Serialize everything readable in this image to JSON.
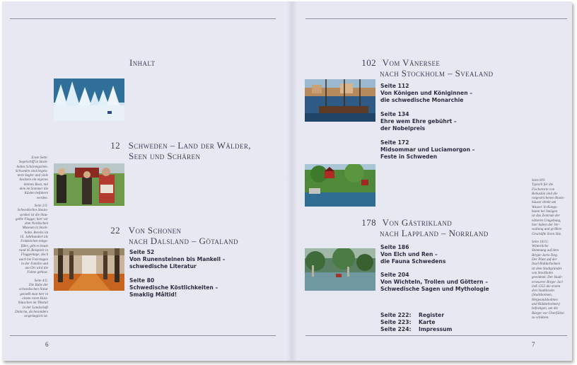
{
  "left_page": {
    "number": "6",
    "title": "Inhalt",
    "sections": [
      {
        "num": "12",
        "line1": "Schweden – Land der Wälder,",
        "line2": "Seen und Schären"
      },
      {
        "num": "22",
        "line1": "Von Schonen",
        "line2": "nach Dalsland – Götaland"
      }
    ],
    "entries": [
      {
        "page": "Seite 52",
        "lines": [
          "Von Runensteinen bis Mankell –",
          "schwedische Literatur"
        ]
      },
      {
        "page": "Seite 80",
        "lines": [
          "Schwedische Köstlichkeiten –",
          "Smaklig Måltid!"
        ]
      }
    ],
    "captions": [
      "Erste Seite:\nSegelschiff in Stock-\nholms Schärengarten.\nSchweden sind begeis-\nterte Segler und viele\nbesitzen ein eigenes\nkleines Boot, mit\ndem im Sommer die\nKüsten befahren\nwerden.",
      "Seite 2/3:\nSchwedisches Staats-\nsymbol ist die blau-\ngelbe Flagge; hier vor\ndem Nordischen\nMuseum in Stock-\nholm. Bereits im\n16. Jahrhundert als\nFeldzeichen mitge-\nführt, gibt es heute\nrund 45 Beispiele in\nFlaggentage, doch\nauch bei Feiertagen\nin der Familie und\nam Ort wird die\nFahne gehisst.",
      "Seite 4/5:\nDie Ruhe der\nschwedischen Natur\ngenießt man hier in\neinem roten Holz-\nhäuschen im Tikettal\nin der Landschaft\nDalarna, da besonders\nursprünglich ist."
    ]
  },
  "right_page": {
    "number": "7",
    "sections": [
      {
        "num": "102",
        "line1": "Vom Vänersee",
        "line2": "nach Stockholm – Svealand"
      },
      {
        "num": "178",
        "line1": "Von Gästrikland",
        "line2": "nach Lappland – Norrland"
      }
    ],
    "entries_svealand": [
      {
        "page": "Seite 112",
        "lines": [
          "Von Königen und Königinnen –",
          "die schwedische Monarchie"
        ]
      },
      {
        "page": "Seite 134",
        "lines": [
          "Ehre wem Ehre gebührt –",
          "der Nobelpreis"
        ]
      },
      {
        "page": "Seite 172",
        "lines": [
          "Midsommar und Luciamorgon –",
          "Feste in Schweden"
        ]
      }
    ],
    "entries_norrland": [
      {
        "page": "Seite 186",
        "lines": [
          "Von Elch und Ren –",
          "die Fauna Schwedens"
        ]
      },
      {
        "page": "Seite 204",
        "lines": [
          "Von Wichteln, Trollen und Göttern –",
          "Schwedische Sagen und Mythologie"
        ]
      }
    ],
    "index": [
      {
        "page": "Seite 222:",
        "label": "Register"
      },
      {
        "page": "Seite 223:",
        "label": "Karte"
      },
      {
        "page": "Seite 224:",
        "label": "Impressum"
      }
    ],
    "captions": [
      "Seite 8/9:\nTypisch für die\nFischerorte von\nBohuslän sind die\nrotgestrichenen Boots-\nhäuser direkt am\nWasser. In Kungs-\nhamn bei Smögen\nist das Zentrum der\nnäheren Umgebung,\nhier haben der Ver-\nwaltung und größere\nGeschäfte ihren Sitz.",
      "Seite 10/11:\nWinterliche\nStimmung auf dem\nBirger-Jarls-Torg.\nDer Platz auf der\nInsel Riddarholmen\nist dem Stadtgründer\nvon Stockholm\ngewidmet. Der Stadt-\nerneuerer Birger Jarl\nließ 1252 die ersten\ndrei Stadtinseln\n(Stadsholmen,\nHelgeandsholmen\nund Riddarholmen)\nbefestigen, um die\nBürger vor Überfällen\nzu schützen."
    ]
  }
}
